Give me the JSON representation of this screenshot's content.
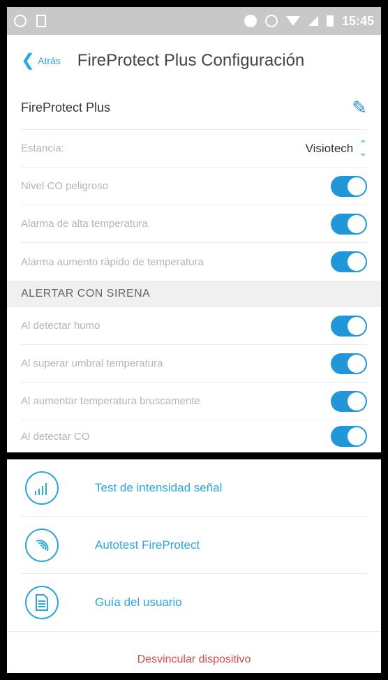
{
  "statusbar": {
    "time": "15:45"
  },
  "header": {
    "back_label": "Atrás",
    "title": "FireProtect Plus Configuración"
  },
  "device": {
    "name": "FireProtect Plus"
  },
  "estancia": {
    "label": "Estancia:",
    "value": "Visiotech"
  },
  "settings": [
    {
      "label": "Nivel CO peligroso",
      "on": true
    },
    {
      "label": "Alarma de alta temperatura",
      "on": true
    },
    {
      "label": "Alarma aumento rápido de temperatura",
      "on": true
    }
  ],
  "siren_section": {
    "title": "ALERTAR CON SIRENA"
  },
  "siren": [
    {
      "label": "Al detectar humo",
      "on": true
    },
    {
      "label": "Al superar umbral temperatura",
      "on": true
    },
    {
      "label": "Al aumentar temperatura bruscamente",
      "on": true
    },
    {
      "label": "Al detectar CO",
      "on": true
    }
  ],
  "actions": [
    {
      "label": "Test de intensidad señal",
      "icon": "signal-icon"
    },
    {
      "label": "Autotest FireProtect",
      "icon": "autotest-icon"
    },
    {
      "label": "Guía del usuario",
      "icon": "document-icon"
    }
  ],
  "unlink_label": "Desvincular dispositivo",
  "colors": {
    "accent": "#29a8e0",
    "toggle": "#2196d9",
    "danger": "#e04848"
  }
}
